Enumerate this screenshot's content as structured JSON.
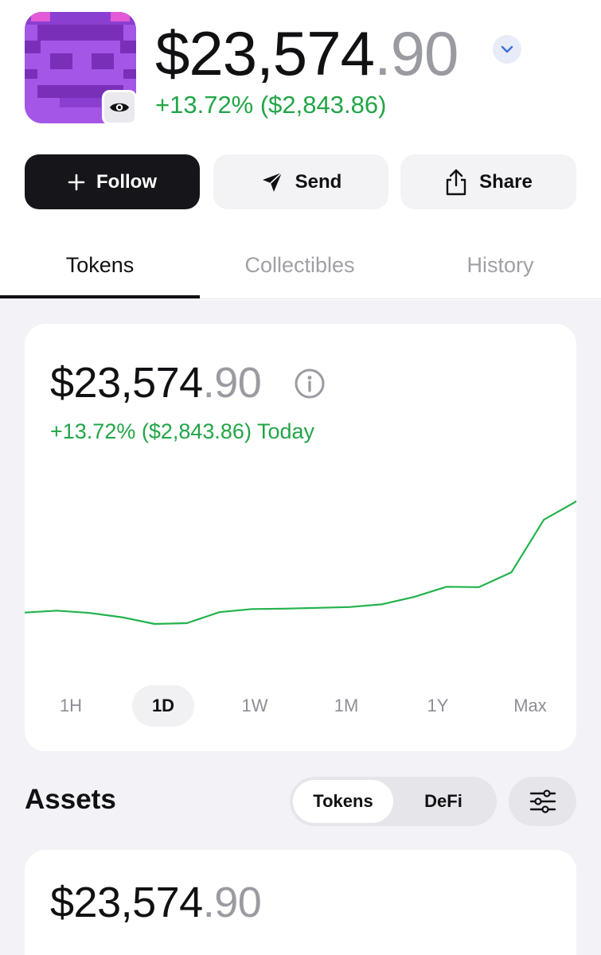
{
  "profile": {
    "balance_int": "$23,574",
    "balance_dec": ".90",
    "change": "+13.72% ($2,843.86)"
  },
  "actions": {
    "follow_label": "Follow",
    "send_label": "Send",
    "share_label": "Share"
  },
  "tabs": [
    {
      "label": "Tokens",
      "active": true
    },
    {
      "label": "Collectibles",
      "active": false
    },
    {
      "label": "History",
      "active": false
    }
  ],
  "chart_card": {
    "balance_int": "$23,574",
    "balance_dec": ".90",
    "change": "+13.72% ($2,843.86) Today",
    "ranges": [
      "1H",
      "1D",
      "1W",
      "1M",
      "1Y",
      "Max"
    ],
    "selected_range": "1D",
    "line_color": "#22b24c"
  },
  "chart_data": {
    "type": "line",
    "title": "",
    "xlabel": "",
    "ylabel": "",
    "series": [
      {
        "name": "",
        "values": [
          20730,
          20780,
          20720,
          20610,
          20440,
          20460,
          20740,
          20820,
          20830,
          20850,
          20870,
          20940,
          21130,
          21390,
          21380,
          21760,
          23100,
          23570
        ]
      }
    ]
  },
  "assets": {
    "title": "Assets",
    "segments": [
      {
        "label": "Tokens",
        "active": true
      },
      {
        "label": "DeFi",
        "active": false
      }
    ],
    "balance_int": "$23,574",
    "balance_dec": ".90"
  },
  "colors": {
    "positive": "#22a547",
    "accent_dark": "#16161a",
    "avatar_purple": "#a456e6"
  }
}
